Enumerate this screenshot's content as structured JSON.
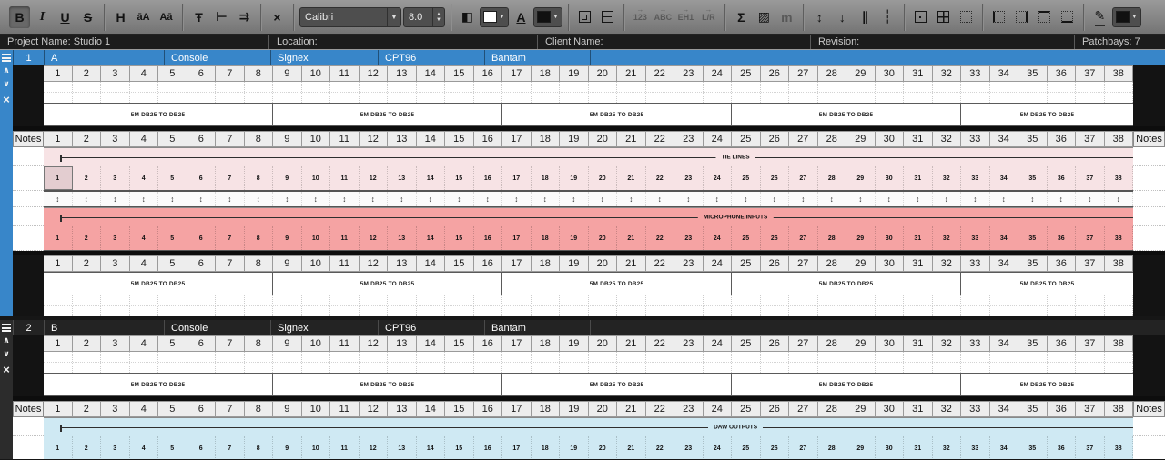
{
  "toolbar": {
    "font_name": "Calibri",
    "font_size": "8.0",
    "groups": [
      {
        "buttons": [
          {
            "name": "bold-button",
            "glyph": "B",
            "active": true
          },
          {
            "name": "italic-button",
            "glyph": "I",
            "style": "italic"
          },
          {
            "name": "underline-button",
            "glyph": "U",
            "style": "underl"
          },
          {
            "name": "strikethrough-button",
            "glyph": "S",
            "style": "strike"
          }
        ]
      },
      {
        "buttons": [
          {
            "name": "header-style-button",
            "glyph": "H"
          },
          {
            "name": "lowercase-to-uppercase-button",
            "glyph": "āA",
            "style": "small"
          },
          {
            "name": "uppercase-to-lowercase-button",
            "glyph": "Aā",
            "style": "small"
          }
        ]
      },
      {
        "buttons": [
          {
            "name": "clear-text-style-button",
            "glyph": "Ŧ"
          },
          {
            "name": "text-align-button",
            "glyph": "⊢"
          },
          {
            "name": "wrap-text-button",
            "glyph": "⇉"
          }
        ]
      },
      {
        "buttons": [
          {
            "name": "clear-font-button",
            "glyph": "×"
          }
        ]
      },
      {
        "buttons": [
          {
            "type": "font-select",
            "name": "font-family-select"
          },
          {
            "type": "size-spinner",
            "name": "font-size-spinner"
          }
        ]
      },
      {
        "buttons": [
          {
            "name": "fill-color-button",
            "glyph": "◧"
          },
          {
            "type": "swatch",
            "name": "fill-color-swatch",
            "color": "#ffffff"
          },
          {
            "name": "font-color-button",
            "glyph": "A",
            "style": "underl"
          },
          {
            "type": "swatch",
            "name": "font-color-swatch",
            "color": "#111111"
          }
        ]
      },
      {
        "buttons": [
          {
            "name": "merge-cells-button",
            "shape": "merge"
          },
          {
            "name": "split-cells-button",
            "shape": "split"
          }
        ]
      },
      {
        "buttons": [
          {
            "name": "number-sequence-button",
            "glyph": "123",
            "seq": true,
            "disabled": true
          },
          {
            "name": "letter-sequence-button",
            "glyph": "ABC",
            "seq": true,
            "disabled": true
          },
          {
            "name": "eh1-sequence-button",
            "glyph": "EH1",
            "seq": true,
            "disabled": true
          },
          {
            "name": "left-right-sequence-button",
            "glyph": "L/R",
            "seq": true,
            "disabled": true
          }
        ]
      },
      {
        "buttons": [
          {
            "name": "formula-button",
            "glyph": "Σ"
          },
          {
            "name": "insert-image-button",
            "glyph": "▨"
          },
          {
            "name": "measure-button",
            "glyph": "m",
            "disabled": true
          }
        ]
      },
      {
        "buttons": [
          {
            "name": "row-height-button",
            "glyph": "↕"
          },
          {
            "name": "shrink-row-button",
            "glyph": "↓"
          },
          {
            "name": "column-split-button",
            "glyph": "∥"
          },
          {
            "name": "column-dotted-button",
            "glyph": "┆"
          }
        ]
      },
      {
        "buttons": [
          {
            "name": "border-outer-button",
            "shape": "border-outer"
          },
          {
            "name": "border-all-button",
            "shape": "border-all"
          },
          {
            "name": "border-none-button",
            "shape": "border-none"
          }
        ]
      },
      {
        "buttons": [
          {
            "name": "border-left-button",
            "shape": "border-left"
          },
          {
            "name": "border-right-button",
            "shape": "border-right"
          },
          {
            "name": "border-top-button",
            "shape": "border-top"
          },
          {
            "name": "border-bottom-button",
            "shape": "border-bottom"
          }
        ]
      },
      {
        "buttons": [
          {
            "name": "draw-border-button",
            "glyph": "✎",
            "style": "pen"
          },
          {
            "type": "swatch",
            "name": "border-color-swatch",
            "color": "#111111"
          }
        ]
      }
    ]
  },
  "info_bar": {
    "project": "Project Name: Studio 1",
    "location": "Location:",
    "client": "Client Name:",
    "revision": "Revision:",
    "patchbays": "Patchbays: 7"
  },
  "grid": {
    "columns": [
      1,
      2,
      3,
      4,
      5,
      6,
      7,
      8,
      9,
      10,
      11,
      12,
      13,
      14,
      15,
      16,
      17,
      18,
      19,
      20,
      21,
      22,
      23,
      24,
      25,
      26,
      27,
      28,
      29,
      30,
      31,
      32,
      33,
      34,
      35,
      36,
      37,
      38
    ],
    "notes_label": "Notes",
    "cable_label": "5M DB25 TO DB25",
    "cable_groups": [
      8,
      8,
      8,
      8,
      6
    ],
    "arrow_glyph": "↕"
  },
  "colors": {
    "selected_header": "#3886c9",
    "unselected_header": "#232323",
    "tie_lines_band": "#f7e3e5",
    "microphone_band": "#f5a3a3",
    "daw_band": "#cfe9f3"
  },
  "patchbays": [
    {
      "number": "1",
      "name": "A",
      "fields": [
        "Console",
        "Signex",
        "CPT96",
        "Bantam"
      ],
      "selected": true,
      "mirror_bottom": true,
      "arrows_between": true,
      "sections": [
        {
          "label": "TIE LINES",
          "color": "#f7e3e5",
          "selected_first_cell": true
        },
        {
          "label": "MICROPHONE INPUTS",
          "color": "#f5a3a3",
          "selected_first_cell": false
        }
      ]
    },
    {
      "number": "2",
      "name": "B",
      "fields": [
        "Console",
        "Signex",
        "CPT96",
        "Bantam"
      ],
      "selected": false,
      "mirror_bottom": false,
      "arrows_between": false,
      "sections": [
        {
          "label": "DAW OUTPUTS",
          "color": "#cfe9f3",
          "selected_first_cell": false
        }
      ]
    }
  ]
}
